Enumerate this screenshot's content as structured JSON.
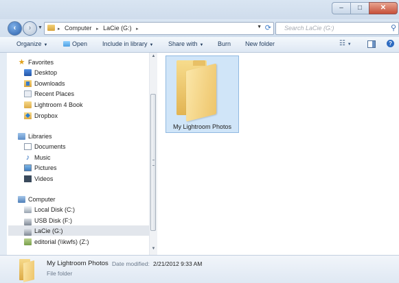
{
  "window": {
    "caption": {
      "minimize": "–",
      "maximize": "□",
      "close": "✕"
    }
  },
  "address": {
    "path": [
      "Computer",
      "LaCie (G:)"
    ],
    "separator": "▸"
  },
  "search": {
    "placeholder": "Search LaCie (G:)"
  },
  "toolbar": {
    "organize": "Organize",
    "open": "Open",
    "include_in_library": "Include in library",
    "share_with": "Share with",
    "burn": "Burn",
    "new_folder": "New folder"
  },
  "nav": {
    "favorites": {
      "label": "Favorites",
      "items": [
        "Desktop",
        "Downloads",
        "Recent Places",
        "Lightroom 4 Book",
        "Dropbox"
      ]
    },
    "libraries": {
      "label": "Libraries",
      "items": [
        "Documents",
        "Music",
        "Pictures",
        "Videos"
      ]
    },
    "computer": {
      "label": "Computer",
      "items": [
        "Local Disk (C:)",
        "USB Disk (F:)",
        "LaCie (G:)",
        "editorial (\\\\kwfs) (Z:)"
      ],
      "selected": "LaCie (G:)"
    }
  },
  "content": {
    "items": [
      {
        "name": "My Lightroom Photos"
      }
    ]
  },
  "details": {
    "name": "My Lightroom Photos",
    "date_modified_label": "Date modified:",
    "date_modified_value": "2/21/2012 9:33 AM",
    "type": "File folder"
  },
  "colors": {
    "selection": "#d0e5f8",
    "selection_border": "#8fb8e0",
    "toolbar_text": "#1e395b"
  }
}
